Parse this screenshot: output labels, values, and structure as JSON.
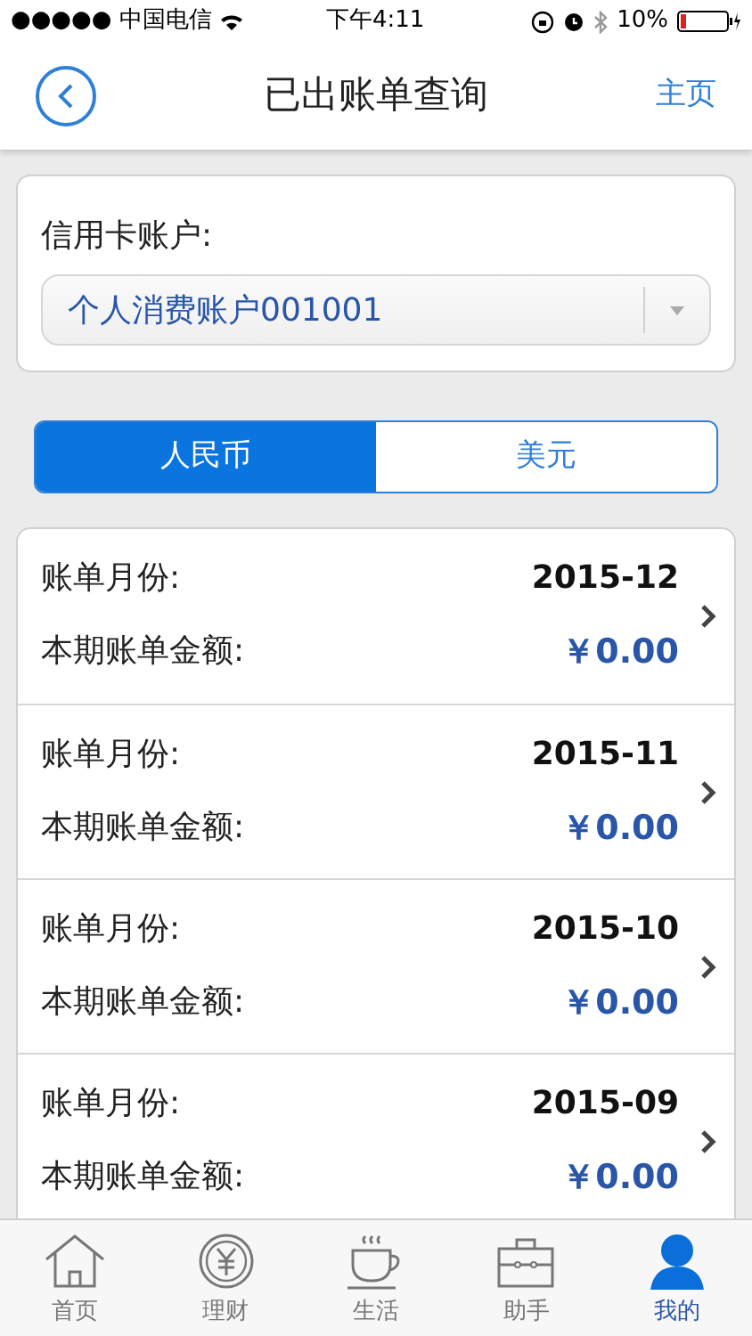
{
  "status_bar": {
    "carrier": "●●●●● 中国电信",
    "time": "下午4:11",
    "battery": "10%"
  },
  "nav": {
    "title": "已出账单查询",
    "home_link": "主页"
  },
  "account": {
    "label": "信用卡账户:",
    "value": "个人消费账户001001"
  },
  "currency_tabs": [
    {
      "label": "人民币",
      "selected": true
    },
    {
      "label": "美元",
      "selected": false
    }
  ],
  "bills": [
    {
      "month_label": "账单月份:",
      "month": "2015-12",
      "amount_label": "本期账单金额:",
      "amount": "￥0.00"
    },
    {
      "month_label": "账单月份:",
      "month": "2015-11",
      "amount_label": "本期账单金额:",
      "amount": "￥0.00"
    },
    {
      "month_label": "账单月份:",
      "month": "2015-10",
      "amount_label": "本期账单金额:",
      "amount": "￥0.00"
    },
    {
      "month_label": "账单月份:",
      "month": "2015-09",
      "amount_label": "本期账单金额:",
      "amount": "￥0.00"
    }
  ],
  "tab_bar": [
    {
      "label": "首页",
      "kind": "home",
      "selected": false
    },
    {
      "label": "理财",
      "kind": "finance",
      "selected": false
    },
    {
      "label": "生活",
      "kind": "life",
      "selected": false
    },
    {
      "label": "助手",
      "kind": "assistant",
      "selected": false
    },
    {
      "label": "我的",
      "kind": "me",
      "selected": true
    }
  ]
}
